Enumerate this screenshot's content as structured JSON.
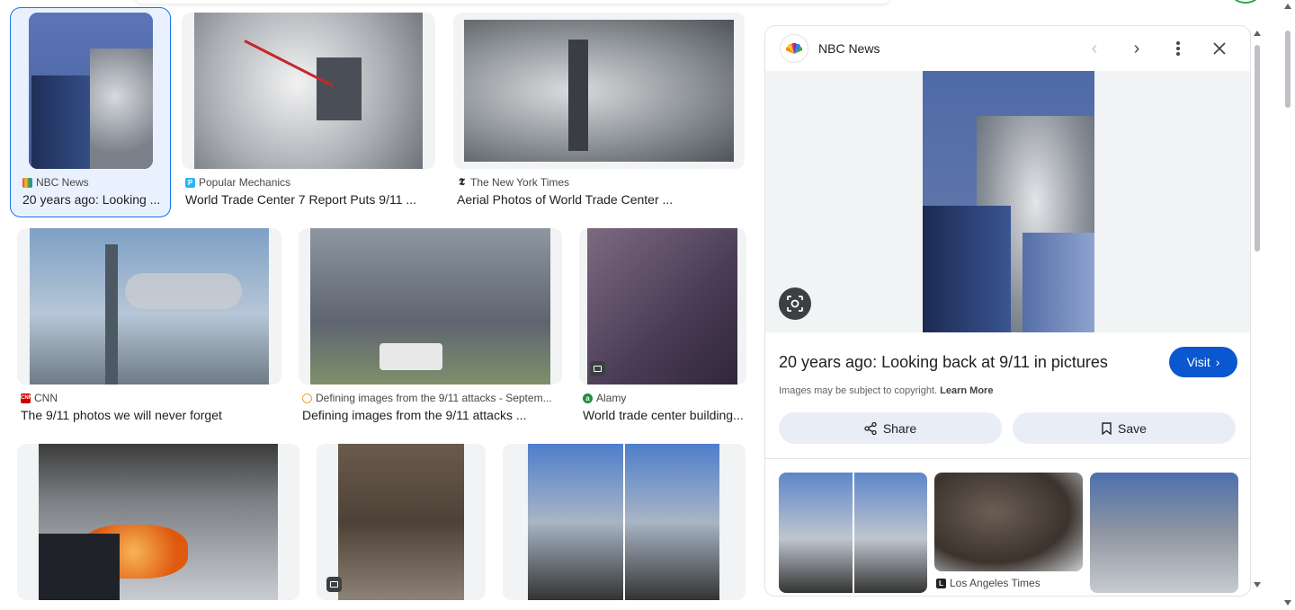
{
  "results": [
    {
      "source": "NBC News",
      "title": "20 years ago: Looking ...",
      "fav_color": "#e53935"
    },
    {
      "source": "Popular Mechanics",
      "title": "World Trade Center 7 Report Puts 9/11 ...",
      "fav_color": "#29b6f6"
    },
    {
      "source": "The New York Times",
      "title": "Aerial Photos of World Trade Center ...",
      "fav_color": "#222222"
    },
    {
      "source": "CNN",
      "title": "The 9/11 photos we will never forget",
      "fav_color": "#cc0000"
    },
    {
      "source": "Defining images from the 9/11 attacks - Septem...",
      "title": "Defining images from the 9/11 attacks ...",
      "fav_color": "#f5a623"
    },
    {
      "source": "Alamy",
      "title": "World trade center building...",
      "fav_color": "#1e8e3e"
    }
  ],
  "panel": {
    "source": "NBC News",
    "title": "20 years ago: Looking back at 9/11 in pictures",
    "visit_label": "Visit",
    "copyright_text": "Images may be subject to copyright.",
    "learn_more": "Learn More",
    "share_label": "Share",
    "save_label": "Save",
    "related_source": "Los Angeles Times",
    "icons": {
      "prev": "chevron-left-icon",
      "next": "chevron-right-icon",
      "more": "more-vert-icon",
      "close": "close-icon",
      "lens": "lens-icon"
    }
  },
  "colors": {
    "accent": "#0b57d0",
    "selected_border": "#1a73e8",
    "pill_bg": "#e9eef6"
  }
}
